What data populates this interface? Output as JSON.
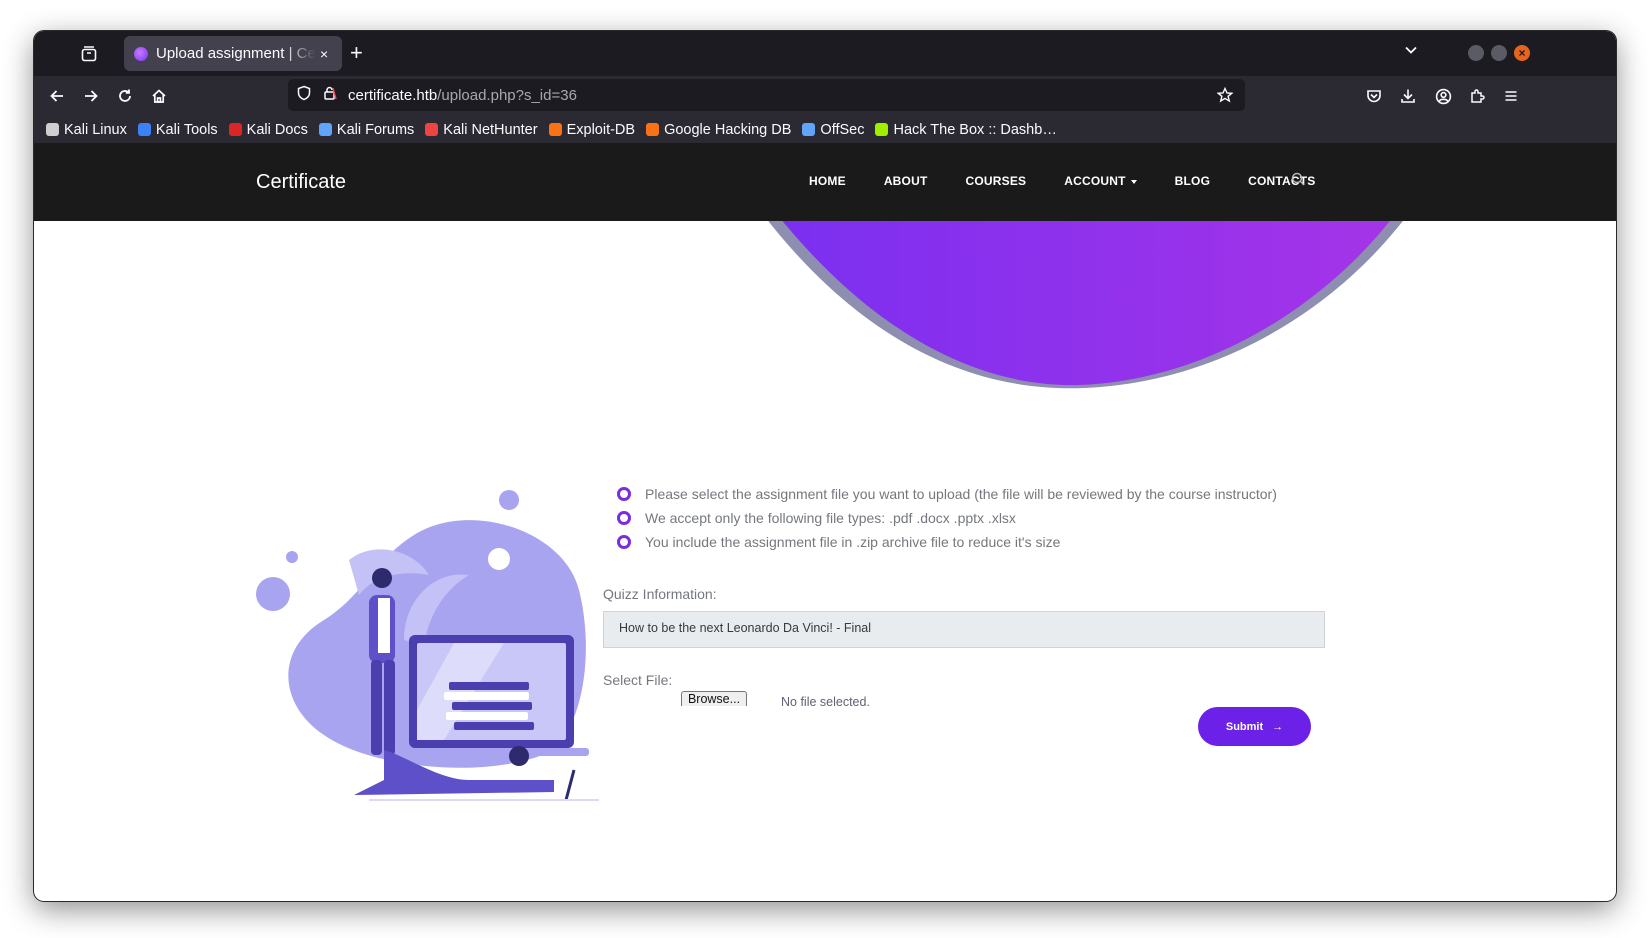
{
  "browser": {
    "tab_title": "Upload assignment | Certificate",
    "tab_close": "×",
    "new_tab": "+",
    "url_host": "certificate.htb",
    "url_path": "/upload.php?s_id=36",
    "window_close": "×",
    "bookmarks": [
      {
        "label": "Kali Linux",
        "icon": "kali-dragon-icon",
        "color": "#cfcfcf"
      },
      {
        "label": "Kali Tools",
        "icon": "kali-tools-icon",
        "color": "#3b82f6"
      },
      {
        "label": "Kali Docs",
        "icon": "kali-docs-icon",
        "color": "#dc2626"
      },
      {
        "label": "Kali Forums",
        "icon": "kali-forums-icon",
        "color": "#60a5fa"
      },
      {
        "label": "Kali NetHunter",
        "icon": "nethunter-icon",
        "color": "#ef4444"
      },
      {
        "label": "Exploit-DB",
        "icon": "exploit-db-icon",
        "color": "#f97316"
      },
      {
        "label": "Google Hacking DB",
        "icon": "ghdb-icon",
        "color": "#f97316"
      },
      {
        "label": "OffSec",
        "icon": "offsec-icon",
        "color": "#60a5fa"
      },
      {
        "label": "Hack The Box :: Dashb…",
        "icon": "htb-cube-icon",
        "color": "#9fef00"
      }
    ]
  },
  "site": {
    "brand": "Certificate",
    "menu": [
      "HOME",
      "ABOUT",
      "COURSES",
      "ACCOUNT",
      "BLOG",
      "CONTACTS"
    ],
    "accent_color": "#6b21e8"
  },
  "upload": {
    "instructions": [
      "Please select the assignment file you want to upload (the file will be reviewed by the course instructor)",
      "We accept only the following file types: .pdf .docx .pptx .xlsx",
      "You include the assignment file in .zip archive file to reduce it's size"
    ],
    "quiz_label": "Quizz Information:",
    "quiz_value": "How to be the next Leonardo Da Vinci! - Final",
    "file_label": "Select File:",
    "browse_label": "Browse...",
    "file_status": "No file selected.",
    "submit_label": "Submit",
    "submit_arrow": "→"
  }
}
